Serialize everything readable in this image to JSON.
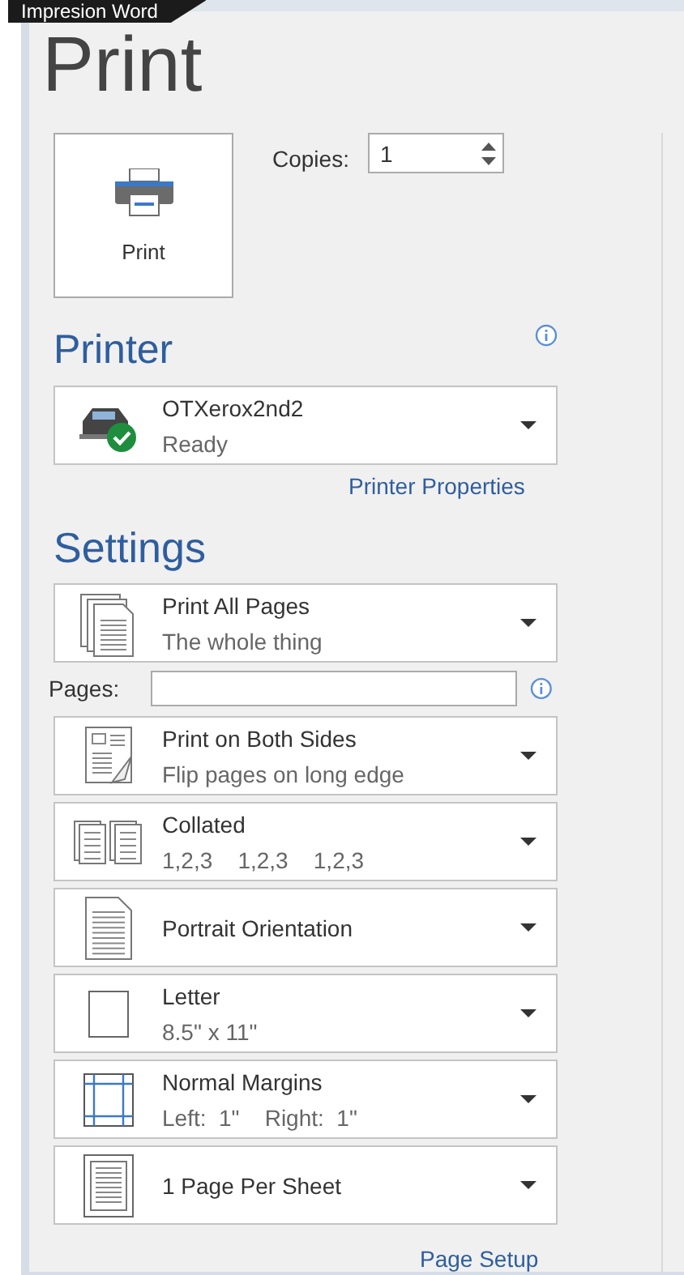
{
  "tab_label": "Impresion Word",
  "title": "Print",
  "print_button": {
    "label": "Print"
  },
  "copies": {
    "label": "Copies:",
    "value": "1"
  },
  "printer": {
    "heading": "Printer",
    "name": "OTXerox2nd2",
    "status": "Ready",
    "properties_link": "Printer Properties"
  },
  "settings": {
    "heading": "Settings",
    "range": {
      "kind": "pages",
      "title": "Print All Pages",
      "subtitle": "The whole thing"
    },
    "pages": {
      "label": "Pages:"
    },
    "options": [
      {
        "kind": "duplex",
        "title": "Print on Both Sides",
        "subtitle": "Flip pages on long edge"
      },
      {
        "kind": "collate",
        "title": "Collated",
        "subtitle": "1,2,3    1,2,3    1,2,3"
      },
      {
        "kind": "portrait",
        "title": "Portrait Orientation"
      },
      {
        "kind": "letter",
        "title": "Letter",
        "subtitle": "8.5\" x 11\""
      },
      {
        "kind": "margins",
        "title": "Normal Margins",
        "subtitle": "Left:  1\"    Right:  1\""
      },
      {
        "kind": "persheet",
        "title": "1 Page Per Sheet"
      }
    ],
    "page_setup_link": "Page Setup"
  }
}
